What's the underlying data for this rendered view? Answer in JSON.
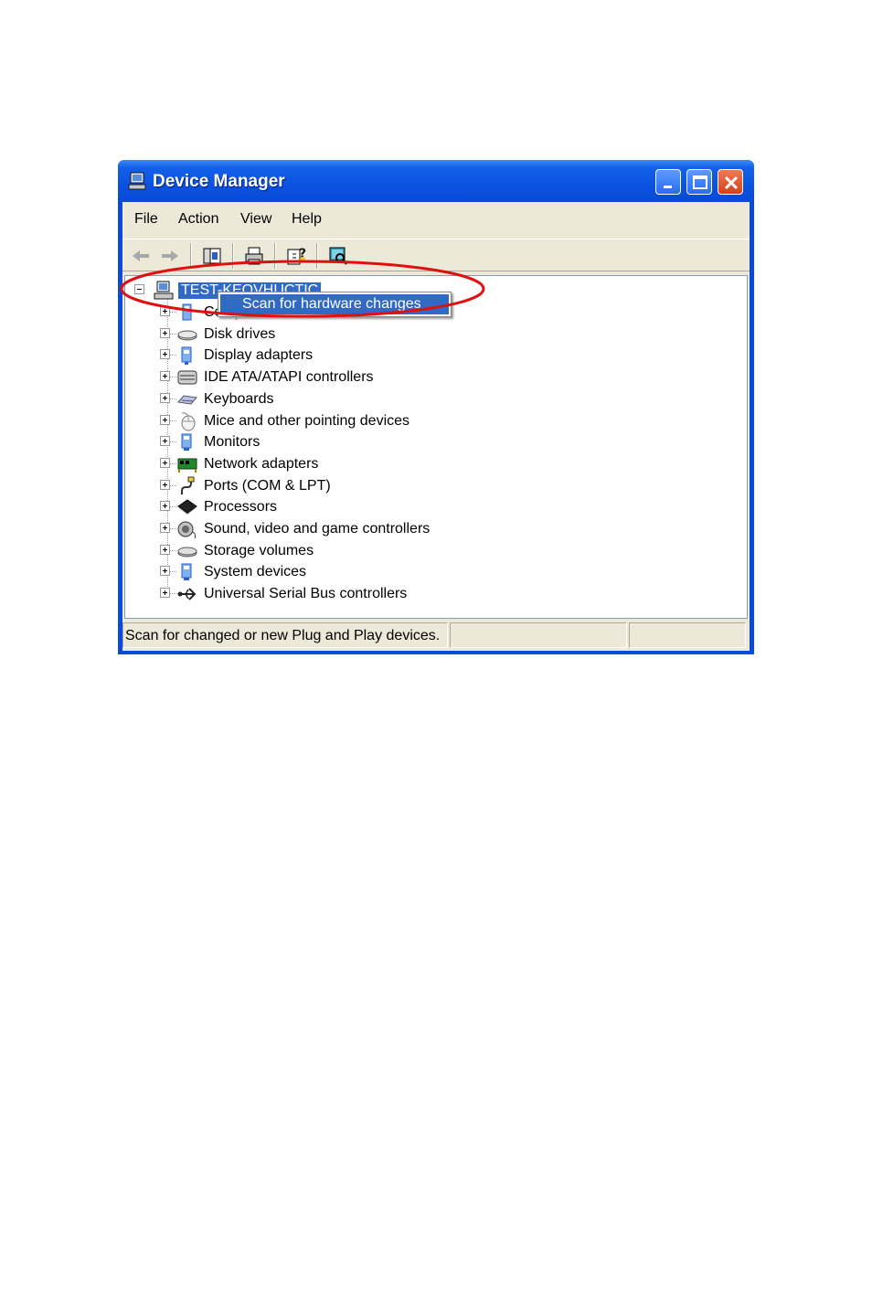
{
  "window": {
    "title": "Device Manager",
    "colors": {
      "titlebar": "#0b52e0",
      "selection": "#316ac5",
      "annotation": "#e01010"
    }
  },
  "menu": {
    "items": [
      "File",
      "Action",
      "View",
      "Help"
    ]
  },
  "toolbar": {
    "icons": [
      "back-arrow-icon",
      "forward-arrow-icon",
      "show-hide-tree-icon",
      "print-icon",
      "properties-help-icon",
      "scan-hardware-icon"
    ]
  },
  "tree": {
    "root": {
      "label": "TEST-KEOVHUCTIC"
    },
    "children": [
      {
        "label": "Computer",
        "icon": "computer-icon"
      },
      {
        "label": "Disk drives",
        "icon": "disk-drive-icon"
      },
      {
        "label": "Display adapters",
        "icon": "display-adapter-icon"
      },
      {
        "label": "IDE ATA/ATAPI controllers",
        "icon": "ide-controller-icon"
      },
      {
        "label": "Keyboards",
        "icon": "keyboard-icon"
      },
      {
        "label": "Mice and other pointing devices",
        "icon": "mouse-icon"
      },
      {
        "label": "Monitors",
        "icon": "monitor-icon"
      },
      {
        "label": "Network adapters",
        "icon": "network-adapter-icon"
      },
      {
        "label": "Ports (COM & LPT)",
        "icon": "port-icon"
      },
      {
        "label": "Processors",
        "icon": "processor-icon"
      },
      {
        "label": "Sound, video and game controllers",
        "icon": "sound-icon"
      },
      {
        "label": "Storage volumes",
        "icon": "storage-volume-icon"
      },
      {
        "label": "System devices",
        "icon": "system-device-icon"
      },
      {
        "label": "Universal Serial Bus controllers",
        "icon": "usb-icon"
      }
    ]
  },
  "context_menu": {
    "item": "Scan for hardware changes"
  },
  "status": {
    "text": "Scan for changed or new Plug and Play devices."
  }
}
